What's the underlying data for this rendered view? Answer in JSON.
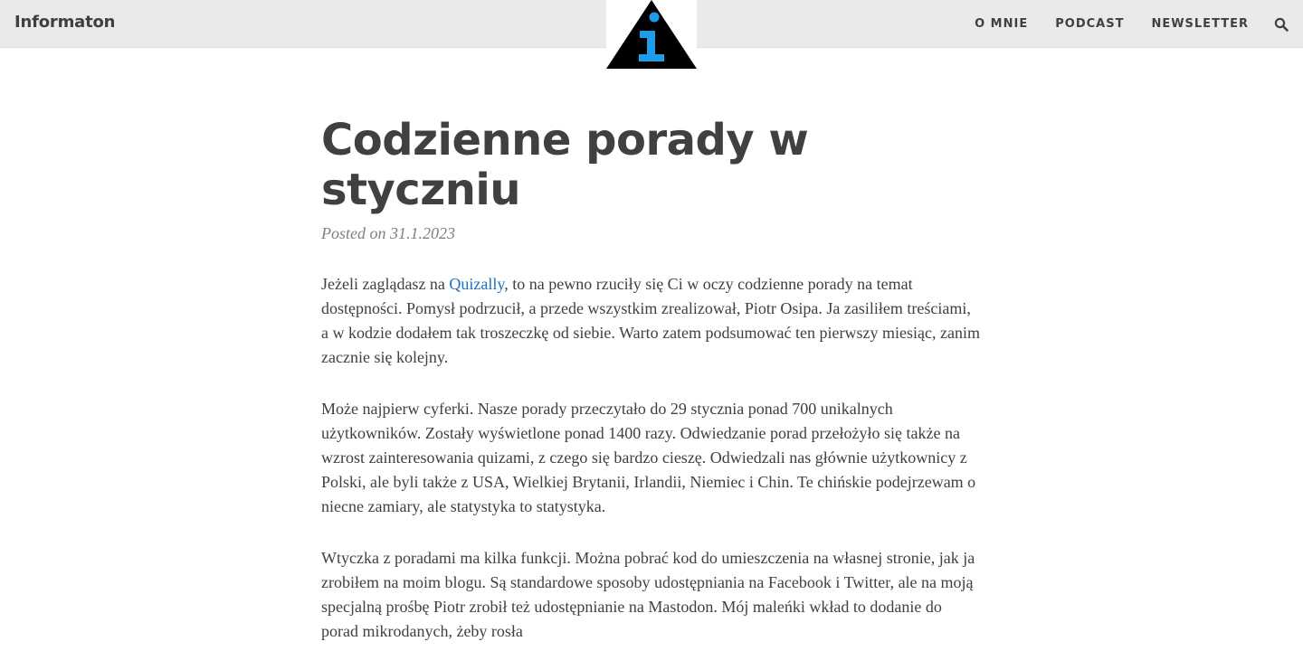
{
  "navbar": {
    "brand": "Informaton",
    "logo": "info-triangle-logo",
    "links": [
      "O MNIE",
      "PODCAST",
      "NEWSLETTER"
    ],
    "search_icon": "search-icon"
  },
  "post": {
    "title": "Codzienne porady w styczniu",
    "meta": "Posted on 31.1.2023",
    "paragraphs": [
      {
        "before": "Jeżeli zaglądasz na ",
        "link": "Quizally",
        "after": ", to na pewno rzuciły się Ci w oczy codzienne porady na temat dostępności. Pomysł podrzucił, a przede wszystkim zrealizował, Piotr Osipa. Ja zasiliłem treściami, a w kodzie dodałem tak troszeczkę od siebie. Warto zatem podsumować ten pierwszy miesiąc, zanim zacznie się kolejny."
      },
      {
        "text": "Może najpierw cyferki. Nasze porady przeczytało do 29 stycznia ponad 700 unikalnych użytkowników. Zostały wyświetlone ponad 1400 razy. Odwiedzanie porad przełożyło się także na wzrost zainteresowania quizami, z czego się bardzo cieszę. Odwiedzali nas głównie użytkownicy z Polski, ale byli także z USA, Wielkiej Brytanii, Irlandii, Niemiec i Chin. Te chińskie podejrzewam o niecne zamiary, ale statystyka to statystyka."
      },
      {
        "text": "Wtyczka z poradami ma kilka funkcji. Można pobrać kod do umieszczenia na własnej stronie, jak ja zrobiłem na moim blogu. Są standardowe sposoby udostępniania na Facebook i Twitter, ale na moją specjalną prośbę Piotr zrobił też udostępnianie na Mastodon. Mój maleńki wkład to dodanie do porad mikrodanych, żeby rosła"
      }
    ]
  },
  "colors": {
    "navbar_bg": "#eaeaea",
    "text": "#404040",
    "meta": "#808080",
    "link": "#1a6fbf",
    "logo_triangle": "#000000",
    "logo_i": "#1e9be9"
  }
}
